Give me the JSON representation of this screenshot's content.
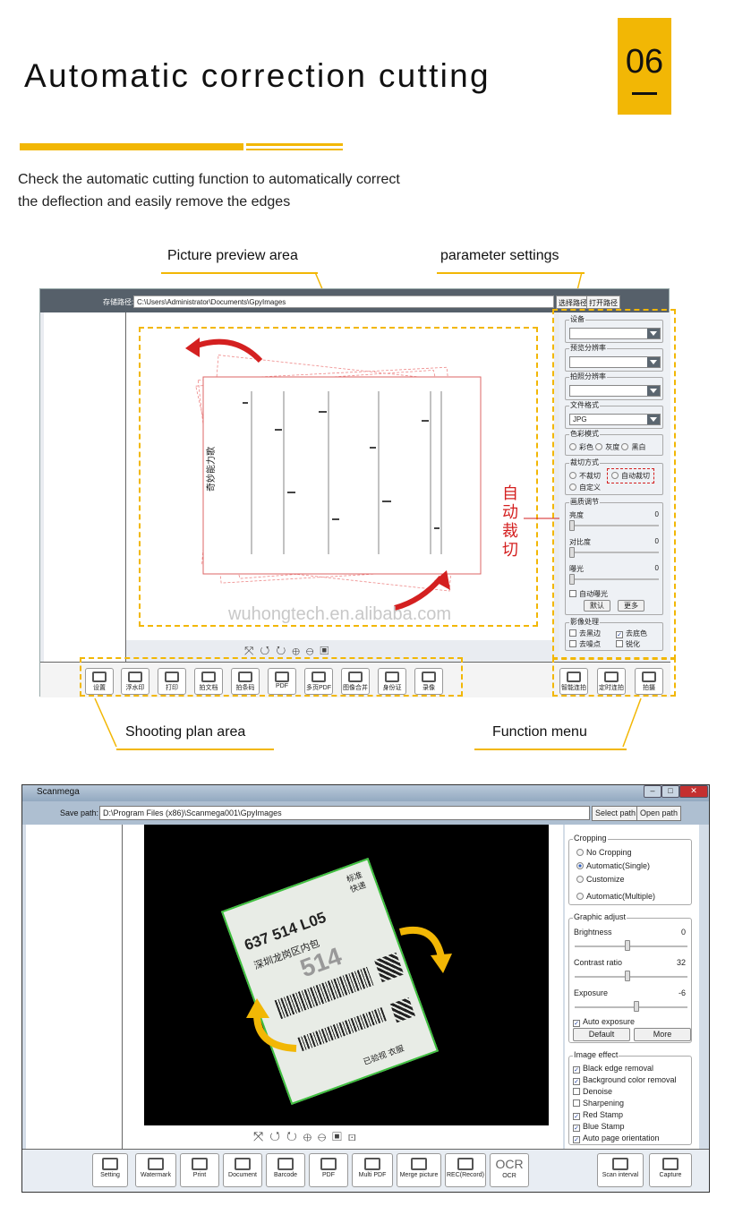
{
  "header": {
    "title": "Automatic correction cutting",
    "badge": "06"
  },
  "description": {
    "line1": "Check the automatic cutting function to automatically correct",
    "line2": "the deflection and easily remove the edges"
  },
  "callouts": {
    "preview": "Picture preview area",
    "params": "parameter settings",
    "plan": "Shooting plan area",
    "function": "Function menu"
  },
  "window1": {
    "path_label": "存储路径:",
    "path_value": "C:\\Users\\Administrator\\Documents\\GpyImages",
    "btn_select": "选择路径",
    "btn_open": "打开路径",
    "groups": {
      "device": "设备",
      "preview_res": "预览分辨率",
      "capture_res": "拍照分辨率",
      "file_format": "文件格式",
      "format_value": "JPG",
      "color_mode": "色彩模式",
      "crop_mode": "裁切方式",
      "image_adjust": "画质调节",
      "image_process": "影像处理"
    },
    "color_options": [
      "彩色",
      "灰度",
      "黑白"
    ],
    "crop_options": [
      "不裁切",
      "自动裁切",
      "自定义"
    ],
    "adjust": {
      "brightness": "亮度",
      "contrast": "对比度",
      "exposure": "曝光",
      "val": "0",
      "auto_exposure": "自动曝光",
      "default": "默认",
      "more": "更多"
    },
    "process": [
      "去黑边",
      "去底色",
      "去噪点",
      "锐化"
    ],
    "red_label": [
      "自",
      "动",
      "裁",
      "切"
    ],
    "doc_title": "奇妙能力歌",
    "watermark": "wuhongtech.en.alibaba.com",
    "toolbar": [
      "设置",
      "浮水印",
      "打印",
      "拍文档",
      "拍条码",
      "PDF",
      "多页PDF",
      "图像合并",
      "身份证",
      "录像"
    ],
    "function_menu": [
      "智能连拍",
      "定时连拍",
      "拍摄"
    ]
  },
  "window2": {
    "title": "Scanmega",
    "path_label": "Save path:",
    "path_value": "D:\\Program Files (x86)\\Scanmega001\\GpyImages",
    "btn_select": "Select path",
    "btn_open": "Open path",
    "cropping": {
      "title": "Cropping",
      "options": [
        "No Cropping",
        "Automatic(Single)",
        "Customize",
        "Automatic(Multiple)"
      ]
    },
    "graphic": {
      "title": "Graphic adjust",
      "brightness": "Brightness",
      "brightness_val": "0",
      "contrast": "Contrast ratio",
      "contrast_val": "32",
      "exposure": "Exposure",
      "exposure_val": "-6",
      "auto_exposure": "Auto exposure",
      "default": "Default",
      "more": "More"
    },
    "effect": {
      "title": "Image effect",
      "items": [
        "Black edge removal",
        "Background color removal",
        "Denoise",
        "Sharpening",
        "Red Stamp",
        "Blue Stamp",
        "Auto page orientation"
      ]
    },
    "label": {
      "code": "637 514 L05",
      "big": "514",
      "loc": "深圳龙岗区内包",
      "tag1": "标准",
      "tag2": "快递",
      "signed": "已验视 衣服"
    },
    "toolbar": [
      "Setting",
      "Watermark",
      "Print",
      "Document",
      "Barcode",
      "PDF",
      "Multi PDF",
      "Merge picture",
      "REC(Record)",
      "OCR"
    ],
    "ocr_icon": "OCR",
    "function_menu": [
      "Scan interval",
      "Capture"
    ]
  },
  "icons": [
    "gear-icon",
    "watermark-icon",
    "printer-icon",
    "document-icon",
    "barcode-icon",
    "pdf-icon",
    "multi-pdf-icon",
    "merge-icon",
    "id-card-icon",
    "video-icon",
    "scan-interval-icon",
    "camera-icon",
    "fit-icon",
    "rotate-left-icon",
    "rotate-right-icon",
    "zoom-in-icon",
    "zoom-out-icon",
    "crop-icon"
  ]
}
